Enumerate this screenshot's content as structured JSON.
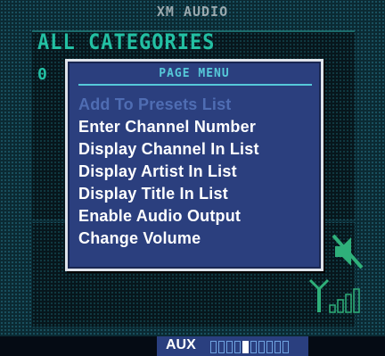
{
  "window": {
    "title": "XM AUDIO"
  },
  "background": {
    "category_label": "ALL CATEGORIES",
    "channel_number": "0"
  },
  "page_menu": {
    "title": "PAGE MENU",
    "items": [
      {
        "label": "Add To Presets List",
        "enabled": false
      },
      {
        "label": "Enter Channel Number",
        "enabled": true
      },
      {
        "label": "Display Channel In List",
        "enabled": true
      },
      {
        "label": "Display Artist In List",
        "enabled": true
      },
      {
        "label": "Display Title In List",
        "enabled": true
      },
      {
        "label": "Enable Audio Output",
        "enabled": true
      },
      {
        "label": "Change Volume",
        "enabled": true
      }
    ]
  },
  "status_bar": {
    "source_label": "AUX",
    "volume_level": 0.5,
    "volume_segments": 10
  },
  "icons": {
    "mute": "speaker-muted-icon",
    "signal": "signal-strength-icon"
  },
  "colors": {
    "menu_bg": "#2b3f7e",
    "menu_title": "#56c9d9",
    "menu_text": "#ffffff",
    "menu_disabled": "#4f6db3",
    "lcd_text": "#23c0a3"
  }
}
